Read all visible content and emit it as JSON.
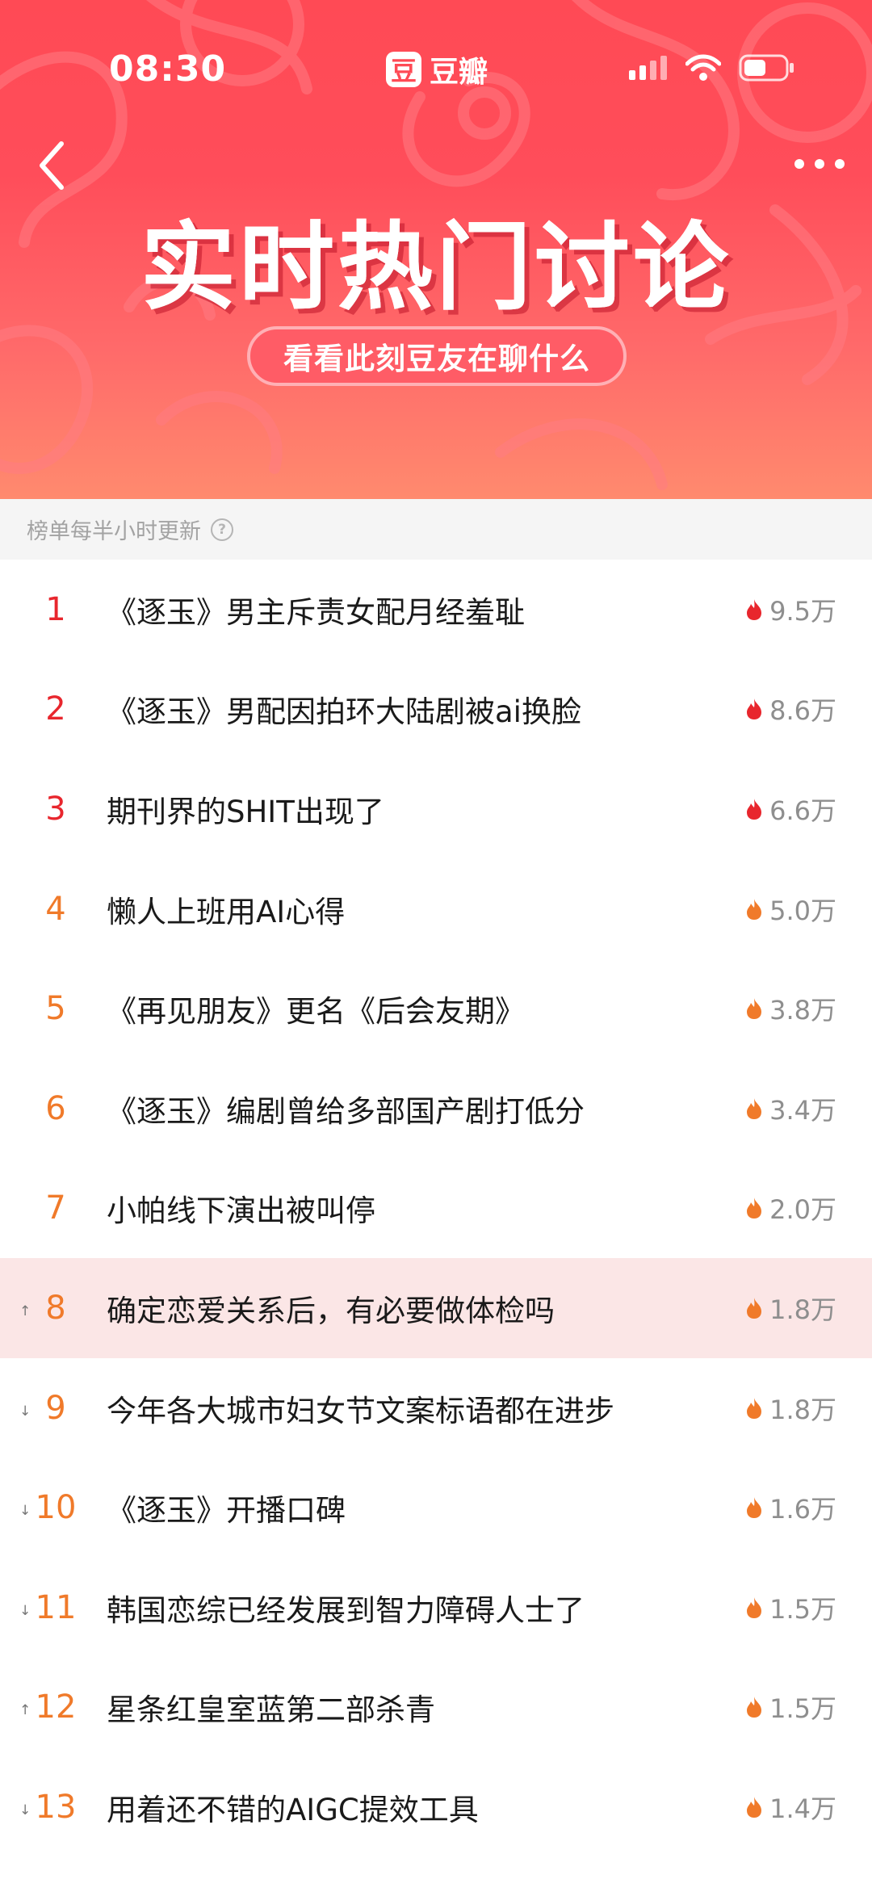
{
  "status_bar": {
    "time": "08:30",
    "app_logo": "豆",
    "app_name": "豆瓣"
  },
  "header": {
    "title": "实时热门讨论",
    "subtitle": "看看此刻豆友在聊什么",
    "back_icon": "chevron-left-icon",
    "more_icon": "more-dots-icon"
  },
  "update_note": {
    "text": "榜单每半小时更新",
    "help_glyph": "?"
  },
  "colors": {
    "hot_red": "#e8262d",
    "warm_orange": "#f07a2a",
    "highlight_bg": "#fbe6e6"
  },
  "list": [
    {
      "rank": "1",
      "title": "《逐玉》男主斥责女配月经羞耻",
      "heat": "9.5万",
      "trend": "",
      "level": "top"
    },
    {
      "rank": "2",
      "title": "《逐玉》男配因拍环大陆剧被ai换脸",
      "heat": "8.6万",
      "trend": "",
      "level": "top"
    },
    {
      "rank": "3",
      "title": "期刊界的SHIT出现了",
      "heat": "6.6万",
      "trend": "",
      "level": "top"
    },
    {
      "rank": "4",
      "title": "懒人上班用AI心得",
      "heat": "5.0万",
      "trend": "",
      "level": "mid"
    },
    {
      "rank": "5",
      "title": "《再见朋友》更名《后会友期》",
      "heat": "3.8万",
      "trend": "",
      "level": "mid"
    },
    {
      "rank": "6",
      "title": "《逐玉》编剧曾给多部国产剧打低分",
      "heat": "3.4万",
      "trend": "",
      "level": "mid"
    },
    {
      "rank": "7",
      "title": "小帕线下演出被叫停",
      "heat": "2.0万",
      "trend": "",
      "level": "mid"
    },
    {
      "rank": "8",
      "title": "确定恋爱关系后，有必要做体检吗",
      "heat": "1.8万",
      "trend": "↑",
      "level": "mid",
      "highlighted": true
    },
    {
      "rank": "9",
      "title": "今年各大城市妇女节文案标语都在进步",
      "heat": "1.8万",
      "trend": "↓",
      "level": "mid"
    },
    {
      "rank": "10",
      "title": "《逐玉》开播口碑",
      "heat": "1.6万",
      "trend": "↓",
      "level": "mid"
    },
    {
      "rank": "11",
      "title": "韩国恋综已经发展到智力障碍人士了",
      "heat": "1.5万",
      "trend": "↓",
      "level": "mid"
    },
    {
      "rank": "12",
      "title": "星条红皇室蓝第二部杀青",
      "heat": "1.5万",
      "trend": "↑",
      "level": "mid"
    },
    {
      "rank": "13",
      "title": "用着还不错的AIGC提效工具",
      "heat": "1.4万",
      "trend": "↓",
      "level": "mid"
    }
  ]
}
